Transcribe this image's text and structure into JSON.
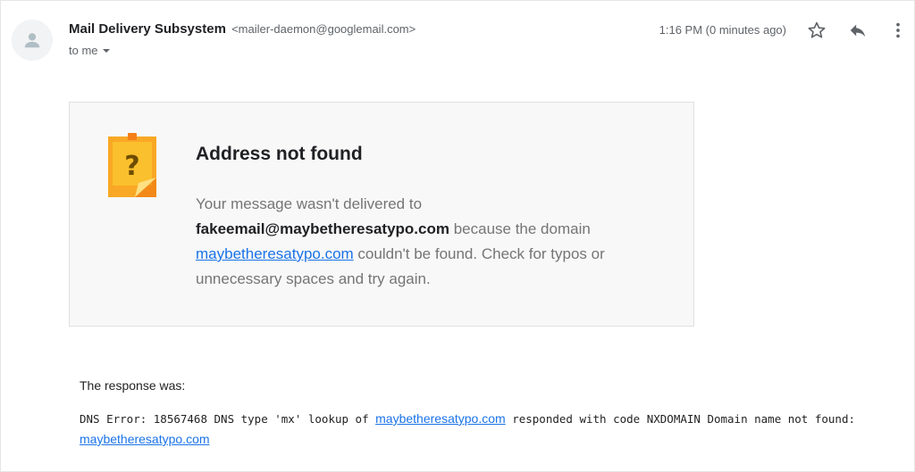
{
  "header": {
    "sender_name": "Mail Delivery Subsystem",
    "sender_email": "<mailer-daemon@googlemail.com>",
    "recipient": "to me",
    "timestamp": "1:16 PM (0 minutes ago)"
  },
  "icons": {
    "avatar": "person-icon",
    "star": "star-icon",
    "reply": "reply-icon",
    "more": "more-vert-icon",
    "dropdown": "caret-down-icon",
    "warning": "question-note-icon"
  },
  "colors": {
    "link": "#1a73e8",
    "note_orange": "#f9a825",
    "card_bg": "#f8f8f8"
  },
  "card": {
    "title": "Address not found",
    "line1": "Your message wasn't delivered to",
    "address": "fakeemail@maybetheresatypo.com",
    "middle": " because the domain ",
    "domain": "maybetheresatypo.com",
    "tail": " couldn't be found. Check for typos or unnecessary spaces and try again."
  },
  "response": {
    "label": "The response was:",
    "text_prefix": "DNS Error: 18567468 DNS type 'mx' lookup of ",
    "domain_link1": "maybetheresatypo.com",
    "text_middle": " responded with code NXDOMAIN Domain name not found: ",
    "domain_link2": "maybetheresatypo.com"
  }
}
